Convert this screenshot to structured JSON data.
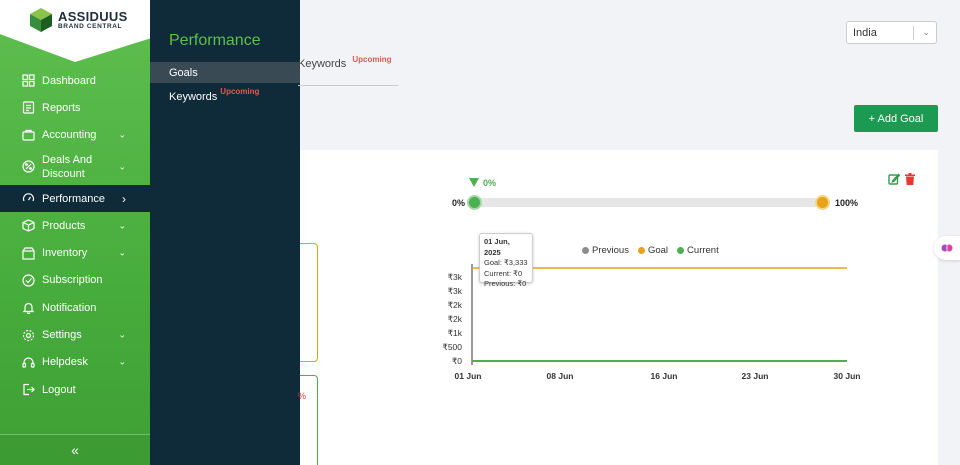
{
  "brand": {
    "name": "ASSIDUUS",
    "sub": "BRAND CENTRAL"
  },
  "sidebar": {
    "items": [
      {
        "label": "Dashboard",
        "icon": "dashboard-icon"
      },
      {
        "label": "Reports",
        "icon": "reports-icon"
      },
      {
        "label": "Accounting",
        "icon": "accounting-icon",
        "expandable": true
      },
      {
        "label": "Deals And Discount",
        "icon": "deals-icon",
        "expandable": true
      },
      {
        "label": "Performance",
        "icon": "performance-icon",
        "expandable": true,
        "active": true
      },
      {
        "label": "Products",
        "icon": "products-icon",
        "expandable": true
      },
      {
        "label": "Inventory",
        "icon": "inventory-icon",
        "expandable": true
      },
      {
        "label": "Subscription",
        "icon": "subscription-icon"
      },
      {
        "label": "Notification",
        "icon": "bell-icon"
      },
      {
        "label": "Settings",
        "icon": "gear-icon",
        "expandable": true
      },
      {
        "label": "Helpdesk",
        "icon": "helpdesk-icon",
        "expandable": true
      },
      {
        "label": "Logout",
        "icon": "logout-icon"
      }
    ],
    "collapse_icon": "double-chevron-left-icon"
  },
  "flyout": {
    "title": "Performance",
    "items": [
      {
        "label": "Goals",
        "badge": ""
      },
      {
        "label": "Keywords",
        "badge": "Upcoming"
      }
    ]
  },
  "tabs": {
    "keywords_label": "Keywords",
    "keywords_badge": "Upcoming"
  },
  "country_select": {
    "value": "India"
  },
  "add_goal_button": "+ Add Goal",
  "side_pct": "%",
  "progress": {
    "marker_label": "0%",
    "start_label": "0%",
    "end_label": "100%",
    "current_fraction": 0.0
  },
  "legend": [
    {
      "name": "Previous",
      "color": "#8c8c8c"
    },
    {
      "name": "Goal",
      "color": "#e8a317"
    },
    {
      "name": "Current",
      "color": "#4caf50"
    }
  ],
  "tooltip": {
    "title": "01 Jun, 2025",
    "goal": "Goal: ₹3,333",
    "current": "Current: ₹0",
    "previous": "Previous: ₹0"
  },
  "chart_data": {
    "type": "line",
    "x_ticks": [
      "01 Jun",
      "08 Jun",
      "16 Jun",
      "23 Jun",
      "30 Jun"
    ],
    "y_ticks": [
      "₹0",
      "₹500",
      "₹1k",
      "₹2k",
      "₹2k",
      "₹3k",
      "₹3k"
    ],
    "ylim": [
      0,
      3333
    ],
    "series": [
      {
        "name": "Goal",
        "color": "#e8a317",
        "values": [
          3333,
          3333
        ]
      },
      {
        "name": "Previous",
        "color": "#8c8c8c",
        "values": [
          0,
          0
        ]
      },
      {
        "name": "Current",
        "color": "#4caf50",
        "values": [
          0,
          0
        ]
      }
    ],
    "x_range": [
      "01 Jun",
      "30 Jun"
    ]
  },
  "colors": {
    "sidebar_green": "#4caf50",
    "dark_navy": "#0f2a38",
    "accent_green": "#1c9a52"
  }
}
